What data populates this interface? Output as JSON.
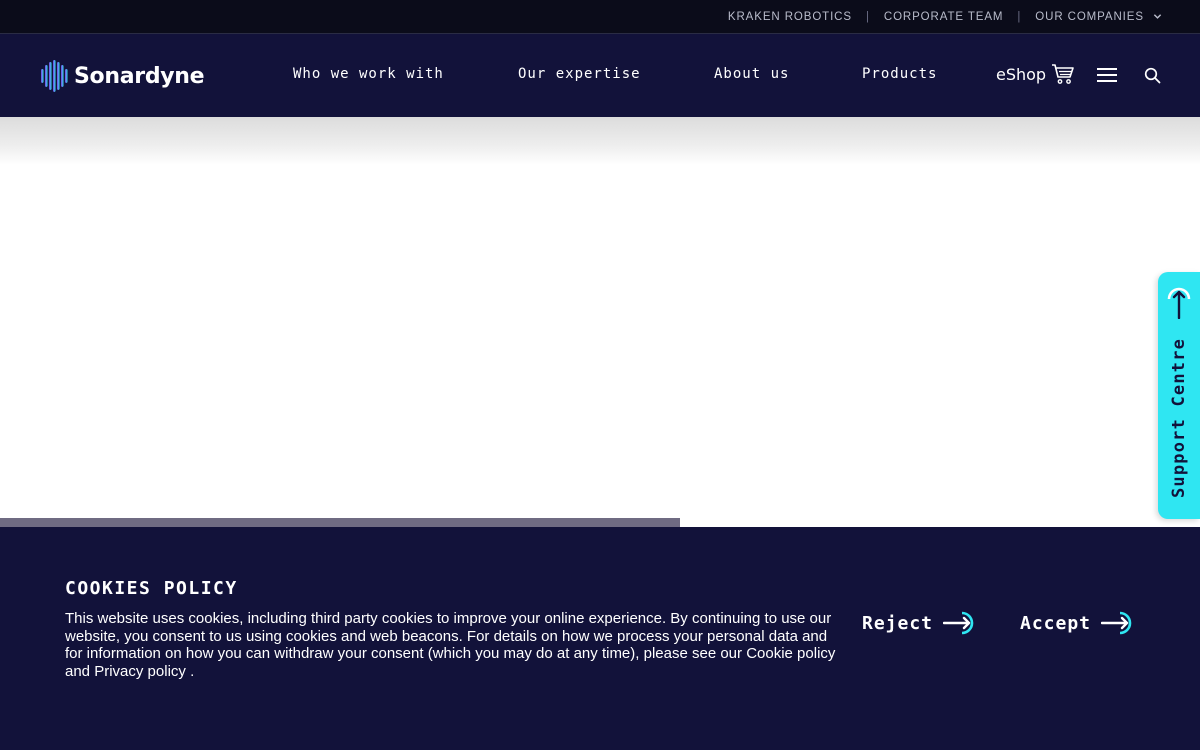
{
  "topbar": {
    "links": [
      "KRAKEN ROBOTICS",
      "CORPORATE TEAM",
      "OUR COMPANIES"
    ],
    "separator": "|"
  },
  "header": {
    "logo_text": "Sonardyne",
    "nav": [
      "Who we work with",
      "Our expertise",
      "About us",
      "Products"
    ],
    "eshop_label": "eShop",
    "icons": [
      "cart-icon",
      "hamburger-menu-icon",
      "search-icon"
    ]
  },
  "hero": {
    "progress_fraction": 0.567
  },
  "support": {
    "label": "Support Centre",
    "icon": "arrow-up-circle-icon",
    "color": "#2fe6f2"
  },
  "cookie": {
    "title": "COOKIES POLICY",
    "text_before": "This website uses cookies, including third party cookies to improve your online experience. By continuing to use our website, you consent to us using cookies and web beacons. For details on how we process your personal data and for information on how you can withdraw your consent (which you may do at any time), please see our ",
    "cookie_link": "Cookie policy",
    "text_and": " and ",
    "privacy_link": "Privacy policy",
    "text_end": " .",
    "reject_label": "Reject",
    "accept_label": "Accept",
    "button_icon": "arrow-right-circle-icon"
  },
  "colors": {
    "navy": "#12123a",
    "topbar": "#0b0c1a",
    "accent": "#2fe6f2",
    "progress": "#6f6b82"
  }
}
